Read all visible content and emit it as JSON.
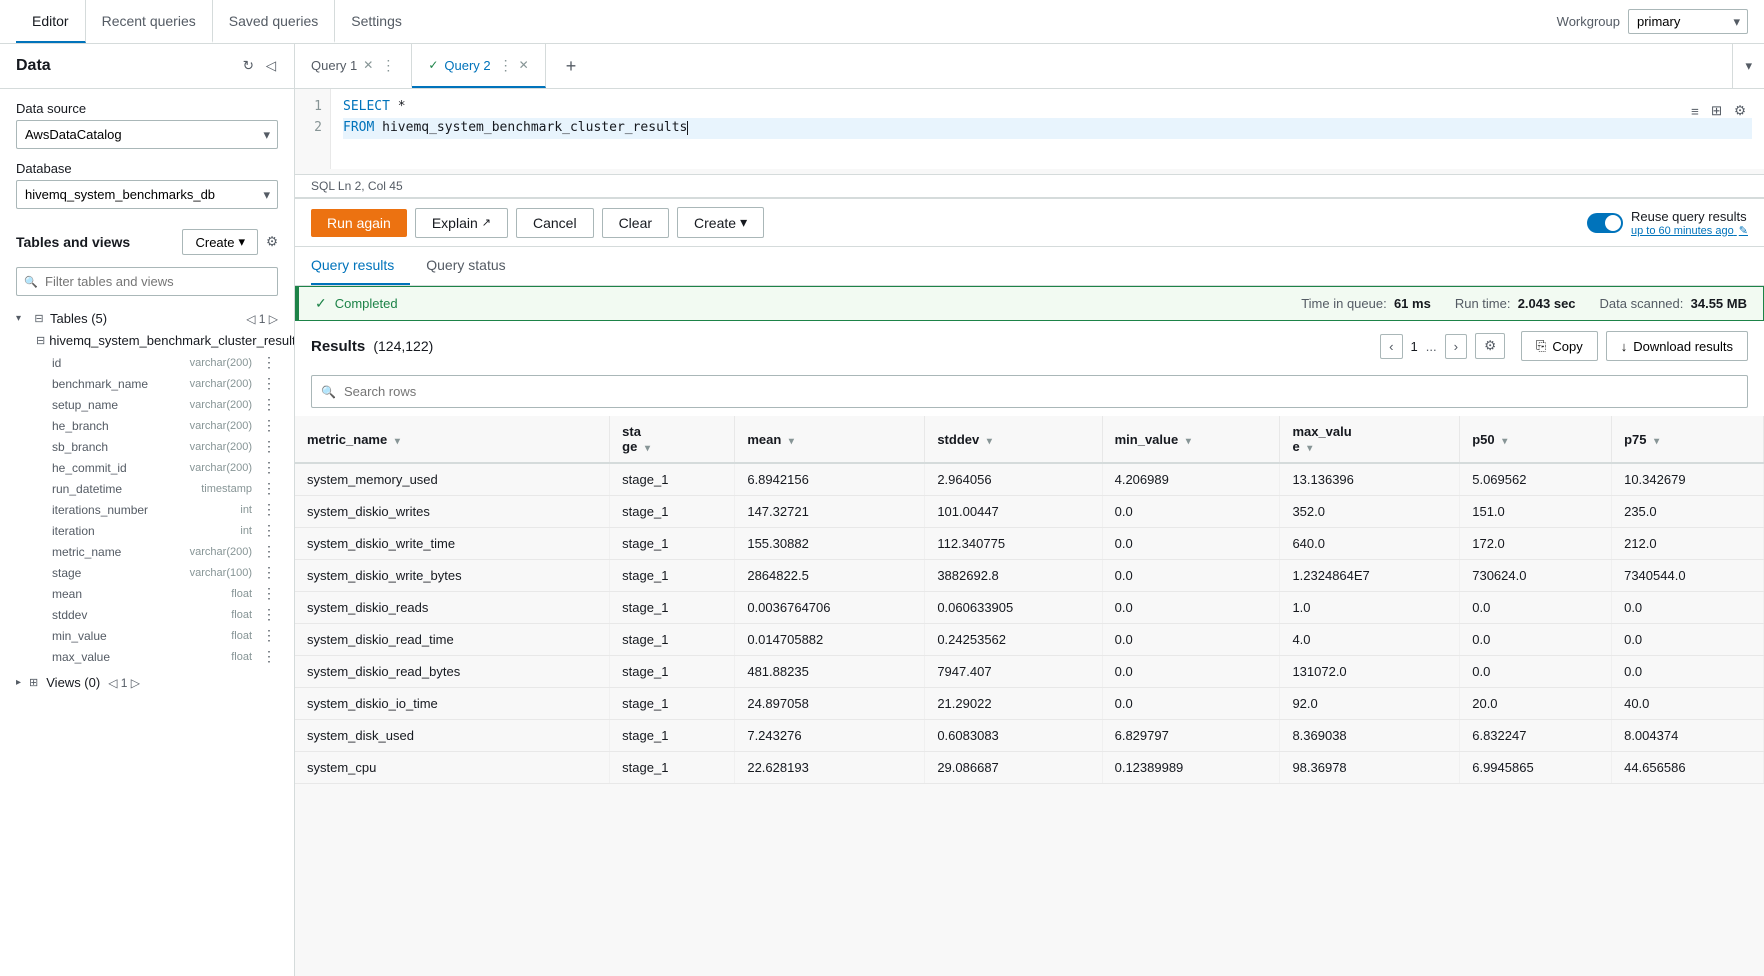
{
  "topNav": {
    "tabs": [
      {
        "label": "Editor",
        "active": true
      },
      {
        "label": "Recent queries",
        "active": false
      },
      {
        "label": "Saved queries",
        "active": false
      },
      {
        "label": "Settings",
        "active": false
      }
    ],
    "workgroup_label": "Workgroup",
    "workgroup_value": "primary"
  },
  "sidebar": {
    "title": "Data",
    "data_source_label": "Data source",
    "data_source_value": "AwsDataCatalog",
    "database_label": "Database",
    "database_value": "hivemq_system_benchmarks_db",
    "tables_views_label": "Tables and views",
    "create_btn": "Create",
    "filter_placeholder": "Filter tables and views",
    "tables_section": {
      "label": "Tables",
      "count": "5",
      "pagination": "1",
      "expand_icon": "▾",
      "collapse_icon": "▸"
    },
    "table_name": "hivemq_system_benchmark_cluster_results",
    "columns": [
      {
        "name": "id",
        "type": "varchar(200)"
      },
      {
        "name": "benchmark_name",
        "type": "varchar(200)"
      },
      {
        "name": "setup_name",
        "type": "varchar(200)"
      },
      {
        "name": "he_branch",
        "type": "varchar(200)"
      },
      {
        "name": "sb_branch",
        "type": "varchar(200)"
      },
      {
        "name": "he_commit_id",
        "type": "varchar(200)"
      },
      {
        "name": "run_datetime",
        "type": "timestamp"
      },
      {
        "name": "iterations_number",
        "type": "int"
      },
      {
        "name": "iteration",
        "type": "int"
      },
      {
        "name": "metric_name",
        "type": "varchar(200)"
      },
      {
        "name": "stage",
        "type": "varchar(100)"
      },
      {
        "name": "mean",
        "type": "float"
      },
      {
        "name": "stddev",
        "type": "float"
      },
      {
        "name": "min_value",
        "type": "float"
      },
      {
        "name": "max_value",
        "type": "float"
      }
    ],
    "views_section": {
      "label": "Views",
      "count": "0",
      "pagination": "1"
    }
  },
  "queryTabs": [
    {
      "label": "Query 1",
      "active": false,
      "hasClose": true
    },
    {
      "label": "Query 2",
      "active": true,
      "hasClose": true,
      "hasCheck": true
    }
  ],
  "editor": {
    "lines": [
      {
        "num": "1",
        "content": "SELECT *",
        "highlighted": false
      },
      {
        "num": "2",
        "content": "FROM hivemq_system_benchmark_cluster_results",
        "highlighted": true
      }
    ],
    "status": "SQL   Ln 2, Col 45"
  },
  "toolbar": {
    "run_again": "Run again",
    "explain": "Explain",
    "cancel": "Cancel",
    "clear": "Clear",
    "create": "Create",
    "reuse_label": "Reuse query results",
    "reuse_sub": "up to 60 minutes ago"
  },
  "resultsTabs": [
    {
      "label": "Query results",
      "active": true
    },
    {
      "label": "Query status",
      "active": false
    }
  ],
  "status": {
    "completed": "Completed",
    "time_in_queue_label": "Time in queue:",
    "time_in_queue_value": "61 ms",
    "run_time_label": "Run time:",
    "run_time_value": "2.043 sec",
    "data_scanned_label": "Data scanned:",
    "data_scanned_value": "34.55 MB"
  },
  "results": {
    "title": "Results",
    "count": "(124,122)",
    "copy_btn": "Copy",
    "download_btn": "Download results",
    "search_placeholder": "Search rows",
    "pagination": {
      "page": "1",
      "dots": "...",
      "prev_label": "‹",
      "next_label": "›"
    },
    "columns": [
      "metric_name",
      "stage",
      "mean",
      "stddev",
      "min_value",
      "max_value",
      "p50",
      "p75"
    ],
    "rows": [
      {
        "metric_name": "system_memory_used",
        "stage": "stage_1",
        "mean": "6.8942156",
        "stddev": "2.964056",
        "min_value": "4.206989",
        "max_value": "13.136396",
        "p50": "5.069562",
        "p75": "10.342679"
      },
      {
        "metric_name": "system_diskio_writes",
        "stage": "stage_1",
        "mean": "147.32721",
        "stddev": "101.00447",
        "min_value": "0.0",
        "max_value": "352.0",
        "p50": "151.0",
        "p75": "235.0"
      },
      {
        "metric_name": "system_diskio_write_time",
        "stage": "stage_1",
        "mean": "155.30882",
        "stddev": "112.340775",
        "min_value": "0.0",
        "max_value": "640.0",
        "p50": "172.0",
        "p75": "212.0"
      },
      {
        "metric_name": "system_diskio_write_bytes",
        "stage": "stage_1",
        "mean": "2864822.5",
        "stddev": "3882692.8",
        "min_value": "0.0",
        "max_value": "1.2324864E7",
        "p50": "730624.0",
        "p75": "7340544.0"
      },
      {
        "metric_name": "system_diskio_reads",
        "stage": "stage_1",
        "mean": "0.0036764706",
        "stddev": "0.060633905",
        "min_value": "0.0",
        "max_value": "1.0",
        "p50": "0.0",
        "p75": "0.0"
      },
      {
        "metric_name": "system_diskio_read_time",
        "stage": "stage_1",
        "mean": "0.014705882",
        "stddev": "0.24253562",
        "min_value": "0.0",
        "max_value": "4.0",
        "p50": "0.0",
        "p75": "0.0"
      },
      {
        "metric_name": "system_diskio_read_bytes",
        "stage": "stage_1",
        "mean": "481.88235",
        "stddev": "7947.407",
        "min_value": "0.0",
        "max_value": "131072.0",
        "p50": "0.0",
        "p75": "0.0"
      },
      {
        "metric_name": "system_diskio_io_time",
        "stage": "stage_1",
        "mean": "24.897058",
        "stddev": "21.29022",
        "min_value": "0.0",
        "max_value": "92.0",
        "p50": "20.0",
        "p75": "40.0"
      },
      {
        "metric_name": "system_disk_used",
        "stage": "stage_1",
        "mean": "7.243276",
        "stddev": "0.6083083",
        "min_value": "6.829797",
        "max_value": "8.369038",
        "p50": "6.832247",
        "p75": "8.004374"
      },
      {
        "metric_name": "system_cpu",
        "stage": "stage_1",
        "mean": "22.628193",
        "stddev": "29.086687",
        "min_value": "0.12389989",
        "max_value": "98.36978",
        "p50": "6.9945865",
        "p75": "44.656586"
      }
    ]
  }
}
